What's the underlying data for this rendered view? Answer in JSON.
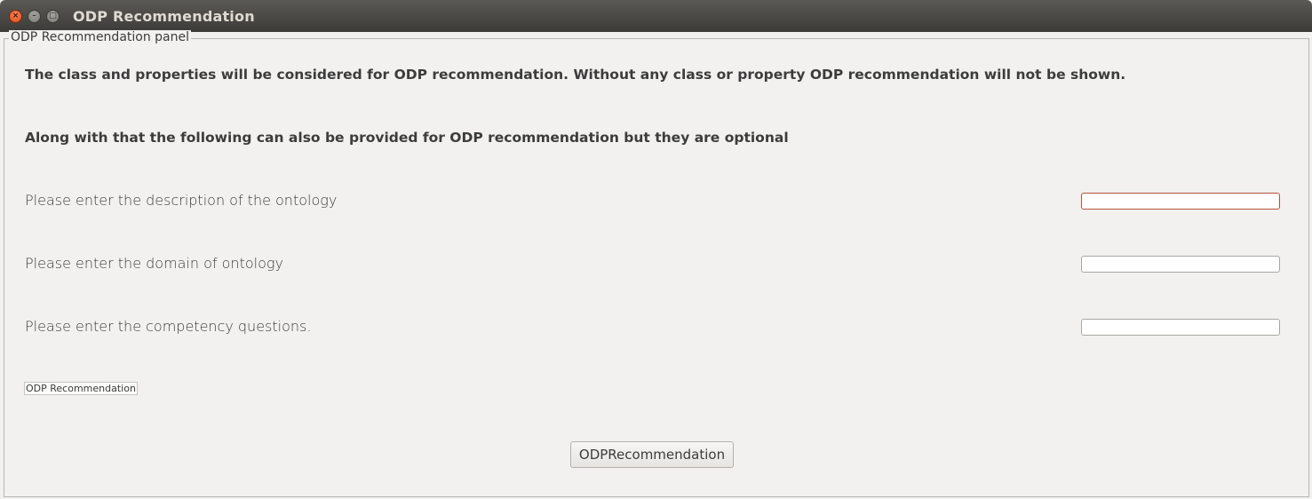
{
  "window": {
    "title": "ODP Recommendation",
    "controls": {
      "close_icon": "close-icon",
      "minimize_icon": "minimize-icon",
      "maximize_icon": "maximize-icon"
    }
  },
  "panel": {
    "legend": "ODP Recommendation panel",
    "intro": "The class and properties will be considered for ODP recommendation. Without any class or property ODP recommendation will not be shown.",
    "optional_note": "Along with that the following can also be provided for ODP recommendation but they are optional",
    "fields": [
      {
        "label": "Please enter the description of the ontology",
        "value": ""
      },
      {
        "label": "Please enter the domain of ontology",
        "value": ""
      },
      {
        "label": "Please enter the competency questions.",
        "value": ""
      }
    ],
    "small_button": "ODP Recommendation",
    "main_button": "ODPRecommendation"
  },
  "colors": {
    "titlebar": "#3c3b37",
    "background": "#f2f1f0",
    "close_button": "#dd4814",
    "focus_border": "#b4523a"
  }
}
